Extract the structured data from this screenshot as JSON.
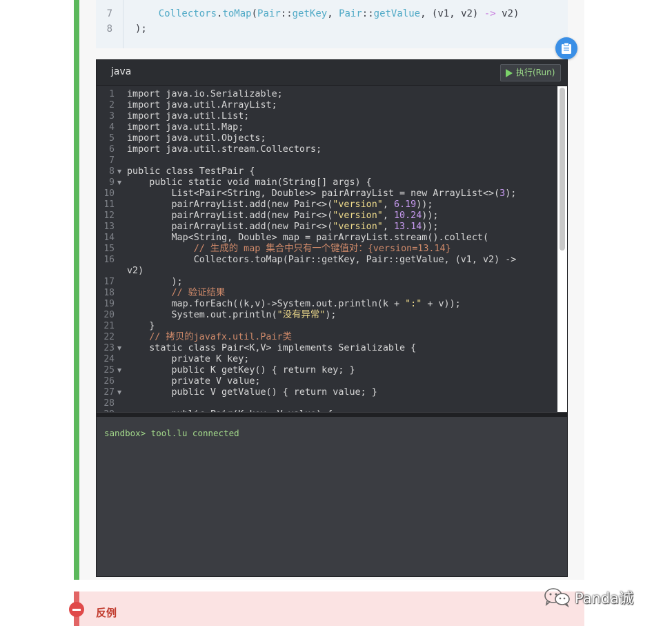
{
  "snippet": {
    "lines": [
      {
        "num": "7",
        "pieces": [
          {
            "t": "    Collectors",
            "c": "s-fn"
          },
          {
            "t": ".",
            "c": "s-txt"
          },
          {
            "t": "toMap",
            "c": "s-fn"
          },
          {
            "t": "(",
            "c": "s-txt"
          },
          {
            "t": "Pair",
            "c": "s-fn"
          },
          {
            "t": "::",
            "c": "s-txt"
          },
          {
            "t": "getKey",
            "c": "s-fn"
          },
          {
            "t": ", ",
            "c": "s-txt"
          },
          {
            "t": "Pair",
            "c": "s-fn"
          },
          {
            "t": "::",
            "c": "s-txt"
          },
          {
            "t": "getValue",
            "c": "s-fn"
          },
          {
            "t": ", (v1, v2) ",
            "c": "s-txt"
          },
          {
            "t": "->",
            "c": "s-op"
          },
          {
            "t": " v2)",
            "c": "s-txt"
          }
        ]
      },
      {
        "num": "8",
        "pieces": [
          {
            "t": ");",
            "c": "s-txt"
          }
        ]
      }
    ]
  },
  "editor": {
    "language": "java",
    "run_label": "执行(Run)",
    "lines": [
      {
        "num": "1",
        "fold": "",
        "pieces": [
          {
            "t": "import java.io.Serializable;"
          }
        ]
      },
      {
        "num": "2",
        "fold": "",
        "pieces": [
          {
            "t": "import java.util.ArrayList;"
          }
        ]
      },
      {
        "num": "3",
        "fold": "",
        "pieces": [
          {
            "t": "import java.util.List;"
          }
        ]
      },
      {
        "num": "4",
        "fold": "",
        "pieces": [
          {
            "t": "import java.util.Map;"
          }
        ]
      },
      {
        "num": "5",
        "fold": "",
        "pieces": [
          {
            "t": "import java.util.Objects;"
          }
        ]
      },
      {
        "num": "6",
        "fold": "",
        "pieces": [
          {
            "t": "import java.util.stream.Collectors;"
          }
        ]
      },
      {
        "num": "7",
        "fold": "",
        "pieces": [
          {
            "t": ""
          }
        ]
      },
      {
        "num": "8",
        "fold": "▼",
        "pieces": [
          {
            "t": "public class TestPair {"
          }
        ]
      },
      {
        "num": "9",
        "fold": "▼",
        "pieces": [
          {
            "t": "    public static void main(String[] args) {"
          }
        ]
      },
      {
        "num": "10",
        "fold": "",
        "pieces": [
          {
            "t": "        List<Pair<String, Double>> pairArrayList = new ArrayList<>("
          },
          {
            "t": "3",
            "c": "c-num"
          },
          {
            "t": ");"
          }
        ]
      },
      {
        "num": "11",
        "fold": "",
        "pieces": [
          {
            "t": "        pairArrayList.add(new Pair<>("
          },
          {
            "t": "\"version\"",
            "c": "c-str"
          },
          {
            "t": ", "
          },
          {
            "t": "6.19",
            "c": "c-num"
          },
          {
            "t": "));"
          }
        ]
      },
      {
        "num": "12",
        "fold": "",
        "pieces": [
          {
            "t": "        pairArrayList.add(new Pair<>("
          },
          {
            "t": "\"version\"",
            "c": "c-str"
          },
          {
            "t": ", "
          },
          {
            "t": "10.24",
            "c": "c-num"
          },
          {
            "t": "));"
          }
        ]
      },
      {
        "num": "13",
        "fold": "",
        "pieces": [
          {
            "t": "        pairArrayList.add(new Pair<>("
          },
          {
            "t": "\"version\"",
            "c": "c-str"
          },
          {
            "t": ", "
          },
          {
            "t": "13.14",
            "c": "c-num"
          },
          {
            "t": "));"
          }
        ]
      },
      {
        "num": "14",
        "fold": "",
        "pieces": [
          {
            "t": "        Map<String, Double> map = pairArrayList.stream().collect("
          }
        ]
      },
      {
        "num": "15",
        "fold": "",
        "pieces": [
          {
            "t": "            // 生成的 map 集合中只有一个键值对：{version=13.14}",
            "c": "c-cmt"
          }
        ]
      },
      {
        "num": "16",
        "fold": "",
        "pieces": [
          {
            "t": "            Collectors.toMap(Pair::getKey, Pair::getValue, (v1, v2) ->"
          }
        ]
      },
      {
        "num": "",
        "fold": "",
        "wrap": true,
        "pieces": [
          {
            "t": "v2)"
          }
        ]
      },
      {
        "num": "17",
        "fold": "",
        "pieces": [
          {
            "t": "        );"
          }
        ]
      },
      {
        "num": "18",
        "fold": "",
        "pieces": [
          {
            "t": "        // 验证结果",
            "c": "c-cmt"
          }
        ]
      },
      {
        "num": "19",
        "fold": "",
        "pieces": [
          {
            "t": "        map.forEach((k,v)->System.out.println(k + "
          },
          {
            "t": "\":\"",
            "c": "c-str"
          },
          {
            "t": " + v));"
          }
        ]
      },
      {
        "num": "20",
        "fold": "",
        "pieces": [
          {
            "t": "        System.out.println("
          },
          {
            "t": "\"没有异常\"",
            "c": "c-str"
          },
          {
            "t": ");"
          }
        ]
      },
      {
        "num": "21",
        "fold": "",
        "pieces": [
          {
            "t": "    }"
          }
        ]
      },
      {
        "num": "22",
        "fold": "",
        "pieces": [
          {
            "t": "    // 拷贝的javafx.util.Pair类",
            "c": "c-cmt"
          }
        ]
      },
      {
        "num": "23",
        "fold": "▼",
        "pieces": [
          {
            "t": "    static class Pair<K,V> implements Serializable {"
          }
        ]
      },
      {
        "num": "24",
        "fold": "",
        "pieces": [
          {
            "t": "        private K key;"
          }
        ]
      },
      {
        "num": "25",
        "fold": "▼",
        "pieces": [
          {
            "t": "        public K getKey() { return key; }"
          }
        ]
      },
      {
        "num": "26",
        "fold": "",
        "pieces": [
          {
            "t": "        private V value;"
          }
        ]
      },
      {
        "num": "27",
        "fold": "▼",
        "pieces": [
          {
            "t": "        public V getValue() { return value; }"
          }
        ]
      },
      {
        "num": "28",
        "fold": "",
        "pieces": [
          {
            "t": ""
          }
        ]
      },
      {
        "num": "29",
        "fold": "▼",
        "pieces": [
          {
            "t": "        public Pair(K key, V value) {"
          }
        ]
      }
    ],
    "console_text": "sandbox> tool.lu connected"
  },
  "counter_example": {
    "label": "反例"
  },
  "watermark": {
    "text": "Panda诚"
  },
  "colors": {
    "accent_green": "#5cb85c",
    "copy_blue": "#3a8fe6",
    "danger_red": "#e04a4a",
    "console_green": "#a3d98b"
  }
}
